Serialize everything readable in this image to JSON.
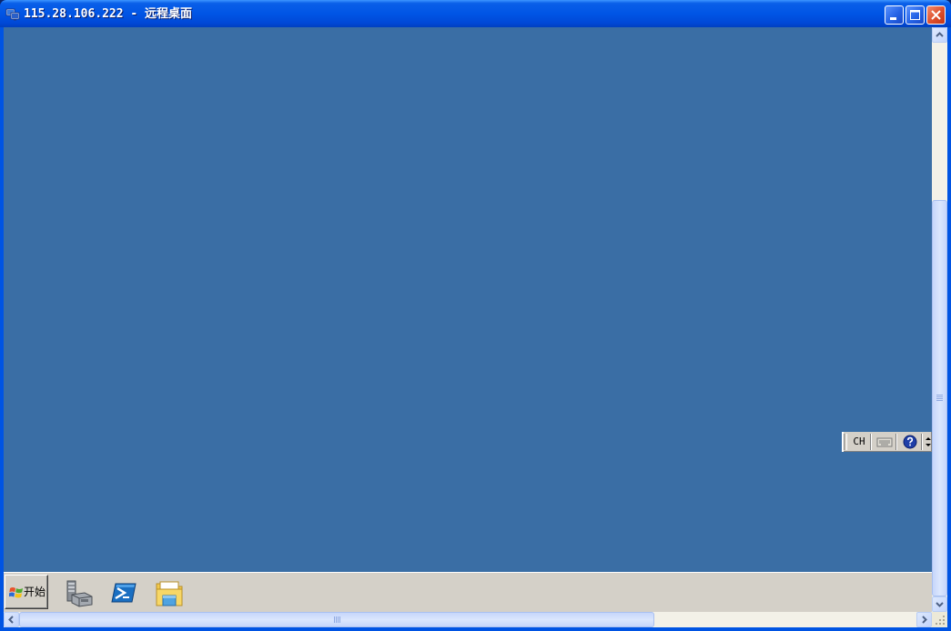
{
  "window": {
    "title": "115.28.106.222 - 远程桌面",
    "icon": "remote-desktop-icon",
    "buttons": [
      "minimize-icon",
      "maximize-icon",
      "close-icon"
    ]
  },
  "desktop": {
    "background_color": "#3a6ea5"
  },
  "language_bar": {
    "language": "CH",
    "icons": [
      "keyboard-icon",
      "help-icon",
      "options-icon"
    ]
  },
  "taskbar": {
    "start_label": "开始",
    "start_icon": "windows-logo-icon",
    "quick_launch": [
      "server-manager-icon",
      "powershell-icon",
      "file-explorer-icon"
    ]
  },
  "colors": {
    "titlebar": "#0054e3",
    "desktop": "#3a6ea5",
    "taskbar": "#d4d0c8",
    "close_button": "#de4f2c"
  }
}
